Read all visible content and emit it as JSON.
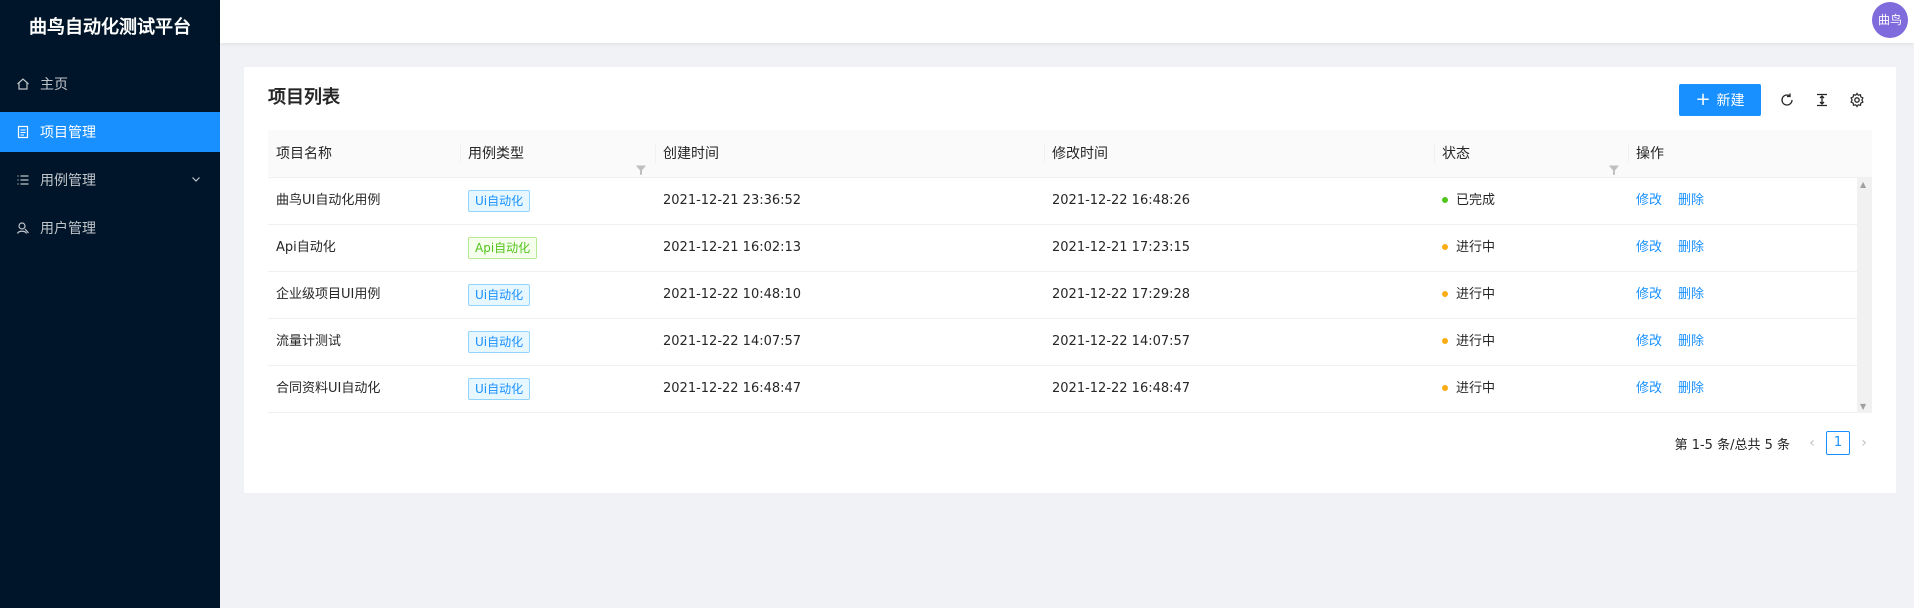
{
  "app": {
    "title": "曲鸟自动化测试平台"
  },
  "sidebar": {
    "items": [
      {
        "label": "主页",
        "icon": "home-icon"
      },
      {
        "label": "项目管理",
        "icon": "file-icon",
        "active": true
      },
      {
        "label": "用例管理",
        "icon": "list-icon",
        "expandable": true
      },
      {
        "label": "用户管理",
        "icon": "user-icon"
      }
    ]
  },
  "header": {
    "avatar_text": "曲鸟"
  },
  "card": {
    "title": "项目列表",
    "new_button": "新建",
    "toolbar_icons": [
      "reload-icon",
      "column-height-icon",
      "setting-icon"
    ]
  },
  "table": {
    "columns": [
      "项目名称",
      "用例类型",
      "创建时间",
      "修改时间",
      "状态",
      "操作"
    ],
    "rows": [
      {
        "name": "曲鸟UI自动化用例",
        "type": "Ui自动化",
        "type_kind": "ui",
        "created": "2021-12-21 23:36:52",
        "modified": "2021-12-22 16:48:26",
        "status": "已完成",
        "status_color": "#52c41a"
      },
      {
        "name": "Api自动化",
        "type": "Api自动化",
        "type_kind": "api",
        "created": "2021-12-21 16:02:13",
        "modified": "2021-12-21 17:23:15",
        "status": "进行中",
        "status_color": "#faad14"
      },
      {
        "name": "企业级项目UI用例",
        "type": "Ui自动化",
        "type_kind": "ui",
        "created": "2021-12-22 10:48:10",
        "modified": "2021-12-22 17:29:28",
        "status": "进行中",
        "status_color": "#faad14"
      },
      {
        "name": "流量计测试",
        "type": "Ui自动化",
        "type_kind": "ui",
        "created": "2021-12-22 14:07:57",
        "modified": "2021-12-22 14:07:57",
        "status": "进行中",
        "status_color": "#faad14"
      },
      {
        "name": "合同资料UI自动化",
        "type": "Ui自动化",
        "type_kind": "ui",
        "created": "2021-12-22 16:48:47",
        "modified": "2021-12-22 16:48:47",
        "status": "进行中",
        "status_color": "#faad14"
      }
    ],
    "actions": {
      "edit": "修改",
      "delete": "删除"
    }
  },
  "pagination": {
    "total_text": "第 1-5 条/总共 5 条",
    "current_page": "1"
  },
  "colors": {
    "primary": "#1890ff",
    "sidebar_bg": "#001529",
    "success": "#52c41a",
    "warning": "#faad14"
  }
}
